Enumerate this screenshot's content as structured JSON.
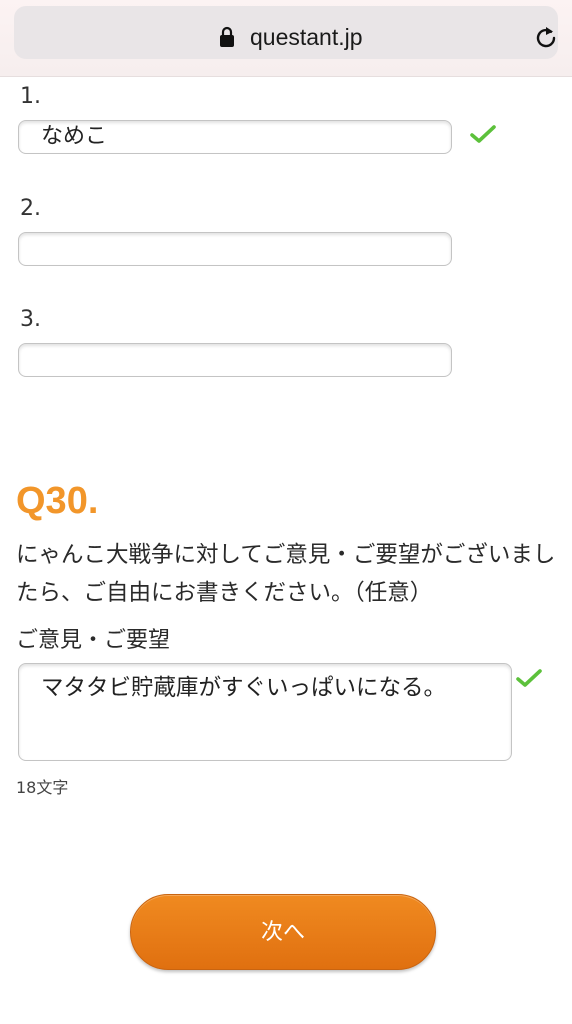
{
  "browser": {
    "url": "questant.jp",
    "lock_icon": "lock-icon",
    "reload_icon": "reload-icon"
  },
  "answers": [
    {
      "label": "1.",
      "value": "なめこ",
      "valid": true
    },
    {
      "label": "2.",
      "value": "",
      "valid": false
    },
    {
      "label": "3.",
      "value": "",
      "valid": false
    }
  ],
  "question": {
    "number": "Q30.",
    "text": "にゃんこ大戦争に対してご意見・ご要望がございましたら、ご自由にお書きください。（任意）",
    "field_label": "ご意見・ご要望",
    "textarea_value": "マタタビ貯蔵庫がすぐいっぱいになる。",
    "char_count": "18文字"
  },
  "next_button": {
    "label": "次へ"
  },
  "colors": {
    "accent": "#f2962a",
    "button": "#ea7d16",
    "check": "#5cc13b"
  }
}
